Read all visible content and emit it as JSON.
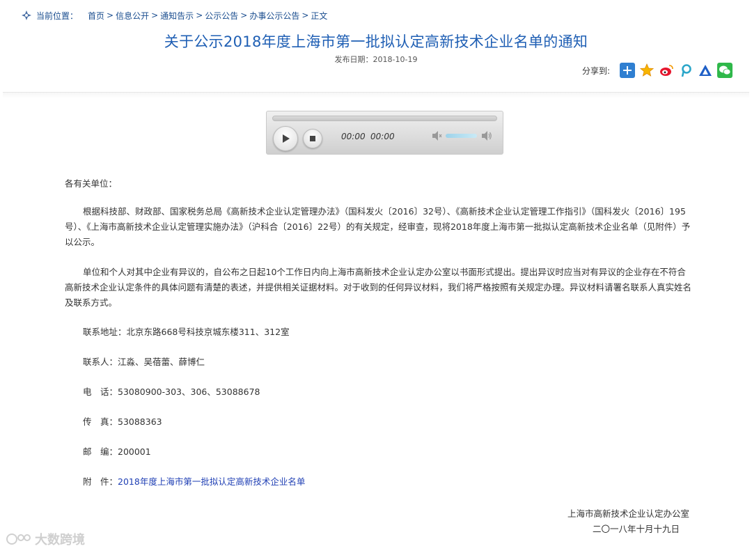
{
  "breadcrumb": {
    "label": "当前位置：",
    "items": [
      "首页",
      "信息公开",
      "通知告示",
      "公示公告",
      "办事公示公告",
      "正文"
    ],
    "separator": ">"
  },
  "article": {
    "title": "关于公示2018年度上海市第一批拟认定高新技术企业名单的通知",
    "date": "发布日期：2018-10-19"
  },
  "share": {
    "label": "分享到:",
    "icons": [
      "more-plus-icon",
      "favorite-star-icon",
      "weibo-icon",
      "pinterest-icon",
      "baidu-icon",
      "wechat-icon"
    ],
    "colors": [
      "#2f7fd1",
      "#f0a500",
      "#e6162d",
      "#2ba6c9",
      "#1e5fc6",
      "#2fb84a"
    ]
  },
  "player": {
    "current_time": "00:00",
    "duration": "00:00"
  },
  "body": {
    "salutation": "各有关单位：",
    "para1": "根据科技部、财政部、国家税务总局《高新技术企业认定管理办法》（国科发火〔2016〕32号）、《高新技术企业认定管理工作指引》（国科发火〔2016〕195号）、《上海市高新技术企业认定管理实施办法》（沪科合〔2016〕22号）的有关规定，经审查，现将2018年度上海市第一批拟认定高新技术企业名单（见附件）予以公示。",
    "para2": "单位和个人对其中企业有异议的，自公布之日起10个工作日内向上海市高新技术企业认定办公室以书面形式提出。提出异议时应当对有异议的企业存在不符合高新技术企业认定条件的具体问题有清楚的表述，并提供相关证据材料。对于收到的任何异议材料，我们将严格按照有关规定办理。异议材料请署名联系人真实姓名及联系方式。"
  },
  "contact": {
    "address": "联系地址：北京东路668号科技京城东楼311、312室",
    "person": "联系人：江淼、吴蓓蕾、薛博仁",
    "phone": "电　话：53080900-303、306、53088678",
    "fax": "传　真：53088363",
    "zip": "邮　编：200001",
    "attachment_label": "附　件：",
    "attachment_link": "2018年度上海市第一批拟认定高新技术企业名单"
  },
  "signature": {
    "org": "上海市高新技术企业认定办公室",
    "date": "二〇一八年十月十九日"
  },
  "watermark": {
    "text": "大数跨境"
  }
}
